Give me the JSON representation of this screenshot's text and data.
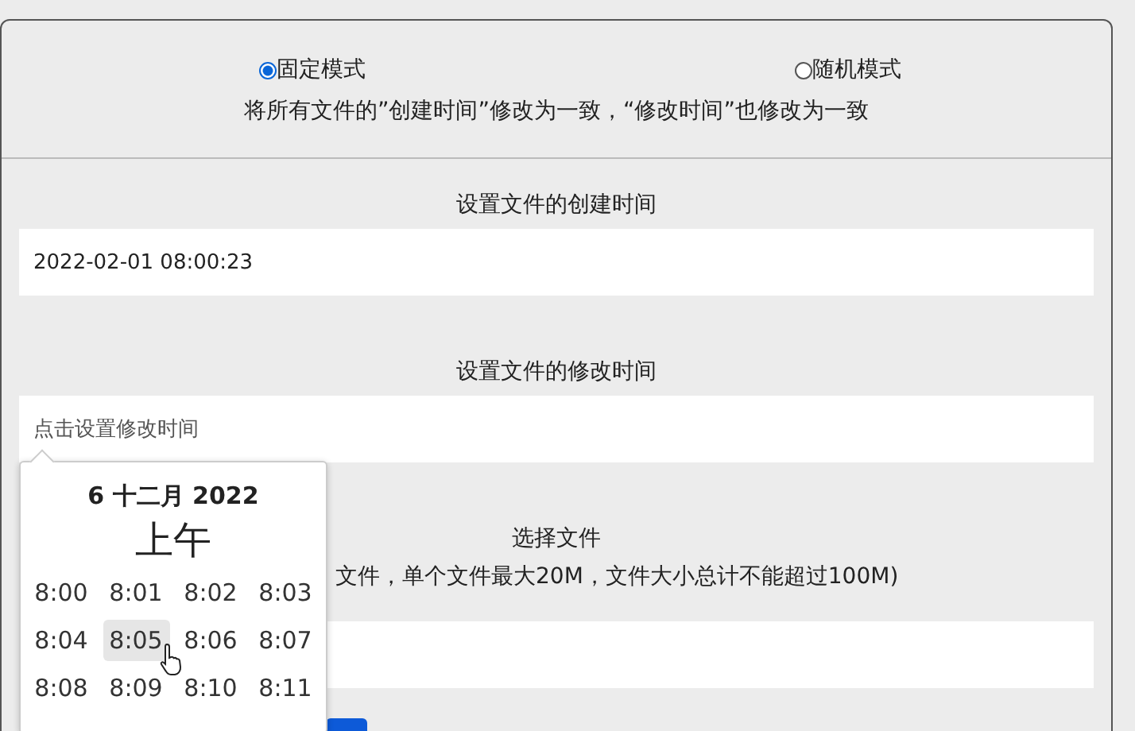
{
  "mode_options": [
    {
      "label": "固定模式",
      "selected": true
    },
    {
      "label": "随机模式",
      "selected": false
    }
  ],
  "mode_description": "将所有文件的”创建时间”修改为一致，“修改时间”也修改为一致",
  "create_time": {
    "label": "设置文件的创建时间",
    "value": "2022-02-01 08:00:23"
  },
  "modify_time": {
    "label": "设置文件的修改时间",
    "placeholder": "点击设置修改时间"
  },
  "file_select": {
    "label": "选择文件",
    "note": "文件，单个文件最大20M，文件大小总计不能超过100M)"
  },
  "time_picker": {
    "date": "6 十二月 2022",
    "period": "上午",
    "times": [
      {
        "label": "8:00",
        "selected": false
      },
      {
        "label": "8:01",
        "selected": false
      },
      {
        "label": "8:02",
        "selected": false
      },
      {
        "label": "8:03",
        "selected": false
      },
      {
        "label": "8:04",
        "selected": false
      },
      {
        "label": "8:05",
        "selected": true
      },
      {
        "label": "8:06",
        "selected": false
      },
      {
        "label": "8:07",
        "selected": false
      },
      {
        "label": "8:08",
        "selected": false
      },
      {
        "label": "8:09",
        "selected": false
      },
      {
        "label": "8:10",
        "selected": false
      },
      {
        "label": "8:11",
        "selected": false
      }
    ]
  }
}
